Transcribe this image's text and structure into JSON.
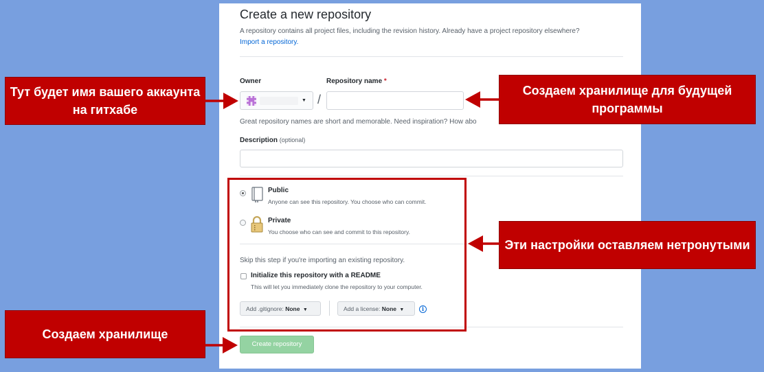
{
  "form": {
    "title": "Create a new repository",
    "subtitle": "A repository contains all project files, including the revision history. Already have a project repository elsewhere?",
    "import_link": "Import a repository.",
    "owner_label": "Owner",
    "repo_name_label": "Repository name",
    "required_mark": "*",
    "slash": "/",
    "repo_name_hint": "Great repository names are short and memorable. Need inspiration? How abo",
    "description_label": "Description",
    "description_optional": "(optional)",
    "visibility": {
      "selected": "Public",
      "public_title": "Public",
      "public_desc": "Anyone can see this repository. You choose who can commit.",
      "private_title": "Private",
      "private_desc": "You choose who can see and commit to this repository."
    },
    "skip_note": "Skip this step if you're importing an existing repository.",
    "init_readme_label": "Initialize this repository with a README",
    "init_readme_desc": "This will let you immediately clone the repository to your computer.",
    "gitignore_prefix": "Add .gitignore:",
    "gitignore_value": "None",
    "license_prefix": "Add a license:",
    "license_value": "None",
    "info_symbol": "i",
    "create_button": "Create repository"
  },
  "callouts": {
    "owner": "Тут будет имя вашего аккаунта на гитхабе",
    "repo": "Создаем хранилище для будущей программы",
    "settings": "Эти настройки оставляем нетронутыми",
    "create": "Создаем хранилище"
  },
  "icons": {
    "owner_avatar": "identicon-icon",
    "public": "repo-book-icon",
    "private": "padlock-icon",
    "dropdown": "caret-down-icon",
    "info": "info-icon",
    "arrow": "arrow-left-icon"
  },
  "colors": {
    "background": "#789fdf",
    "callout": "#c00000",
    "link": "#0366d6",
    "create_button": "#94d3a2",
    "required": "#cb2431"
  }
}
